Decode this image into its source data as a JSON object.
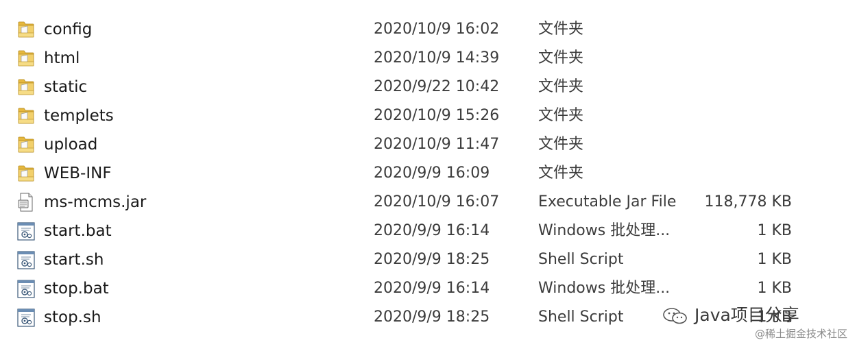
{
  "files": [
    {
      "name": "config",
      "modified": "2020/10/9 16:02",
      "type": "文件夹",
      "size": "",
      "icon": "folder-icon"
    },
    {
      "name": "html",
      "modified": "2020/10/9 14:39",
      "type": "文件夹",
      "size": "",
      "icon": "folder-icon"
    },
    {
      "name": "static",
      "modified": "2020/9/22 10:42",
      "type": "文件夹",
      "size": "",
      "icon": "folder-icon"
    },
    {
      "name": "templets",
      "modified": "2020/10/9 15:26",
      "type": "文件夹",
      "size": "",
      "icon": "folder-icon"
    },
    {
      "name": "upload",
      "modified": "2020/10/9 11:47",
      "type": "文件夹",
      "size": "",
      "icon": "folder-icon"
    },
    {
      "name": "WEB-INF",
      "modified": "2020/9/9 16:09",
      "type": "文件夹",
      "size": "",
      "icon": "folder-icon"
    },
    {
      "name": "ms-mcms.jar",
      "modified": "2020/10/9 16:07",
      "type": "Executable Jar File",
      "size": "118,778 KB",
      "icon": "jar-file-icon"
    },
    {
      "name": "start.bat",
      "modified": "2020/9/9 16:14",
      "type": "Windows 批处理...",
      "size": "1 KB",
      "icon": "script-file-icon"
    },
    {
      "name": "start.sh",
      "modified": "2020/9/9 18:25",
      "type": "Shell Script",
      "size": "1 KB",
      "icon": "script-file-icon"
    },
    {
      "name": "stop.bat",
      "modified": "2020/9/9 16:14",
      "type": "Windows 批处理...",
      "size": "1 KB",
      "icon": "script-file-icon"
    },
    {
      "name": "stop.sh",
      "modified": "2020/9/9 18:25",
      "type": "Shell Script",
      "size": "1 KB",
      "icon": "script-file-icon"
    }
  ],
  "watermark": {
    "main": "Java项目分享",
    "sub": "@稀土掘金技术社区"
  },
  "colors": {
    "folder_body": "#f2d06b",
    "folder_tab": "#e6b83f",
    "text_primary": "#1a1a1a",
    "text_secondary": "#3c3c3c"
  }
}
